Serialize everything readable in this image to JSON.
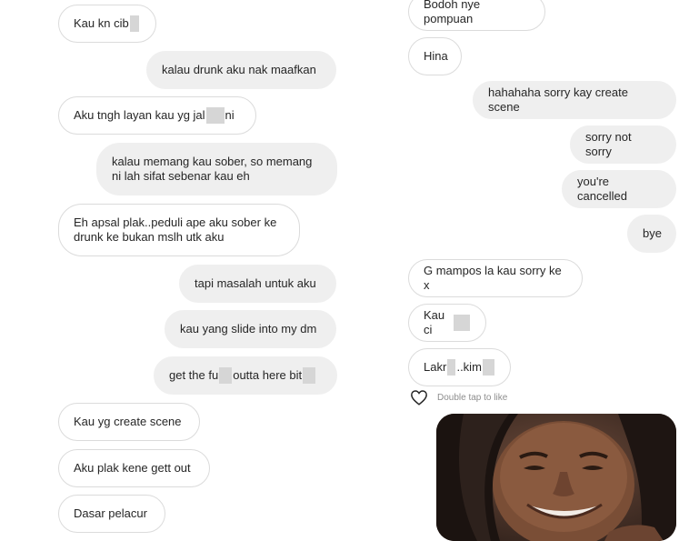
{
  "left_chat": {
    "messages": [
      {
        "side": "received",
        "parts": [
          "Kau kn cib",
          ""
        ]
      },
      {
        "side": "sent",
        "parts": [
          "kalau drunk aku nak maafkan"
        ]
      },
      {
        "side": "received",
        "parts": [
          "Aku tngh layan kau yg jal",
          " ni"
        ]
      },
      {
        "side": "sent",
        "parts": [
          "kalau memang kau sober, so memang\nni lah sifat sebenar kau eh"
        ]
      },
      {
        "side": "received",
        "parts": [
          "Eh apsal plak..peduli ape aku sober ke\ndrunk ke bukan mslh utk aku"
        ]
      },
      {
        "side": "sent",
        "parts": [
          "tapi masalah untuk aku"
        ]
      },
      {
        "side": "sent",
        "parts": [
          "kau yang slide into my dm"
        ]
      },
      {
        "side": "sent",
        "parts": [
          "get the fu",
          "outta here bit"
        ]
      },
      {
        "side": "received",
        "parts": [
          "Kau yg create scene"
        ]
      },
      {
        "side": "received",
        "parts": [
          "Aku plak kene gett out"
        ]
      },
      {
        "side": "received",
        "parts": [
          "Dasar pelacur"
        ]
      }
    ]
  },
  "right_chat": {
    "messages": [
      {
        "side": "received",
        "parts": [
          "Bodoh nye pompuan"
        ]
      },
      {
        "side": "received",
        "parts": [
          "Hina"
        ]
      },
      {
        "side": "sent",
        "parts": [
          "hahahaha sorry kay create scene"
        ]
      },
      {
        "side": "sent",
        "parts": [
          "sorry not sorry"
        ]
      },
      {
        "side": "sent",
        "parts": [
          "you're cancelled"
        ]
      },
      {
        "side": "sent",
        "parts": [
          "bye"
        ]
      },
      {
        "side": "received",
        "parts": [
          "G mampos la kau sorry ke x"
        ]
      },
      {
        "side": "received",
        "parts": [
          "Kau ci",
          ""
        ]
      },
      {
        "side": "received",
        "parts": [
          "Lakr",
          "..kim",
          ""
        ]
      }
    ],
    "like_hint": "Double tap to like",
    "photo_alt": "smiling person with long dark hair"
  },
  "icons": {
    "heart": "heart-icon"
  },
  "colors": {
    "sent_bubble": "#efefef",
    "received_border": "#dbdbdb",
    "hint_text": "#8e8e8e"
  }
}
